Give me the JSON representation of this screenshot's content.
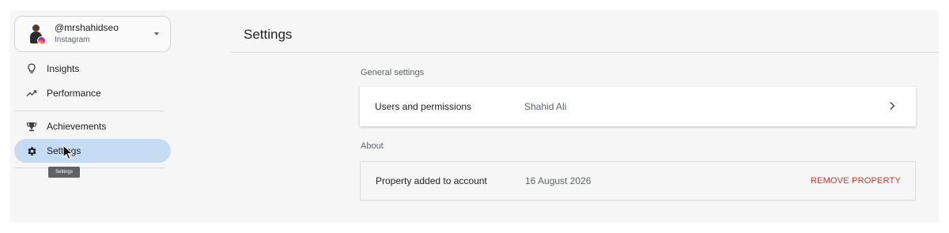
{
  "account": {
    "name": "@mrshahidseo",
    "platform": "Instagram"
  },
  "nav": {
    "insights": "Insights",
    "performance": "Performance",
    "achievements": "Achievements",
    "settings": "Settings",
    "active_item": "Settings"
  },
  "tooltip": "Settings",
  "header": {
    "title": "Settings"
  },
  "general": {
    "label": "General settings",
    "row": {
      "key": "Users and permissions",
      "value": "Shahid Ali"
    }
  },
  "about": {
    "label": "About",
    "row": {
      "key": "Property added to account",
      "value": "16 August 2026",
      "action": "REMOVE PROPERTY"
    }
  },
  "colors": {
    "active_nav_bg": "#c6dcf5",
    "danger_action": "#c5392d"
  },
  "icons": {
    "insights": "lightbulb-icon",
    "performance": "trending-up-icon",
    "achievements": "trophy-icon",
    "settings": "gear-icon",
    "row_chevron": "chevron-right-icon",
    "account_menu": "caret-down-icon"
  }
}
